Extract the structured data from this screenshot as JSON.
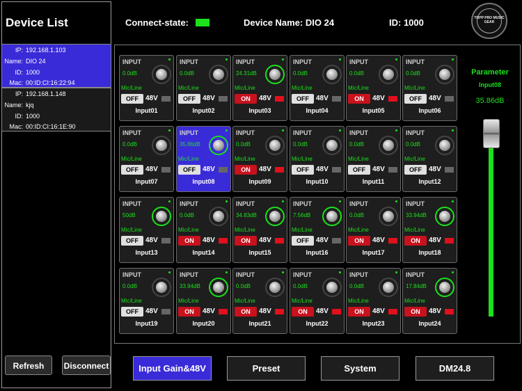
{
  "sidebar": {
    "title": "Device List",
    "devices": [
      {
        "ip_key": "IP:",
        "ip": "192.168.1.103",
        "name_key": "Name:",
        "name": "DIO 24",
        "id_key": "ID:",
        "id": "1000",
        "mac_key": "Mac:",
        "mac": "00:ID:CI:16:22:94"
      },
      {
        "ip_key": "IP:",
        "ip": "192.168.1.148",
        "name_key": "Name:",
        "name": "kjq",
        "id_key": "ID:",
        "id": "1000",
        "mac_key": "Mac:",
        "mac": "00:ID:CI:16:1E:90"
      }
    ],
    "refresh_label": "Refresh",
    "disconnect_label": "Disconnect"
  },
  "header": {
    "connect_label": "Connect-state:",
    "device_name_label": "Device Name: DIO 24",
    "id_label": "ID: 1000",
    "logo_text": "TOPP PRO MUSIC GEAR"
  },
  "colors": {
    "accent": "#3a2bd8",
    "green": "#1be01b",
    "red": "#c8121e"
  },
  "channels": [
    {
      "title": "INPUT",
      "value": "0.0dB",
      "mic": "Mic/Line",
      "phantom": "OFF",
      "v48": "48V",
      "name": "Input01",
      "knob_active": false,
      "selected": false
    },
    {
      "title": "INPUT",
      "value": "0.0dB",
      "mic": "Mic/Line",
      "phantom": "OFF",
      "v48": "48V",
      "name": "Input02",
      "knob_active": false,
      "selected": false
    },
    {
      "title": "INPUT",
      "value": "24.31dB",
      "mic": "Mic/Line",
      "phantom": "ON",
      "v48": "48V",
      "name": "Input03",
      "knob_active": true,
      "selected": false
    },
    {
      "title": "INPUT",
      "value": "0.0dB",
      "mic": "Mic/Line",
      "phantom": "OFF",
      "v48": "48V",
      "name": "Input04",
      "knob_active": false,
      "selected": false
    },
    {
      "title": "INPUT",
      "value": "0.0dB",
      "mic": "Mic/Line",
      "phantom": "ON",
      "v48": "48V",
      "name": "Input05",
      "knob_active": false,
      "selected": false
    },
    {
      "title": "INPUT",
      "value": "0.0dB",
      "mic": "Mic/Line",
      "phantom": "OFF",
      "v48": "48V",
      "name": "Input06",
      "knob_active": false,
      "selected": false
    },
    {
      "title": "INPUT",
      "value": "0.0dB",
      "mic": "Mic/Line",
      "phantom": "OFF",
      "v48": "48V",
      "name": "Input07",
      "knob_active": false,
      "selected": false
    },
    {
      "title": "INPUT",
      "value": "35.86dB",
      "mic": "Mic/Line",
      "phantom": "OFF",
      "v48": "48V",
      "name": "Input08",
      "knob_active": true,
      "selected": true
    },
    {
      "title": "INPUT",
      "value": "0.0dB",
      "mic": "Mic/Line",
      "phantom": "ON",
      "v48": "48V",
      "name": "Input09",
      "knob_active": false,
      "selected": false
    },
    {
      "title": "INPUT",
      "value": "0.0dB",
      "mic": "Mic/Line",
      "phantom": "OFF",
      "v48": "48V",
      "name": "Input10",
      "knob_active": false,
      "selected": false
    },
    {
      "title": "INPUT",
      "value": "0.0dB",
      "mic": "Mic/Line",
      "phantom": "OFF",
      "v48": "48V",
      "name": "Input11",
      "knob_active": false,
      "selected": false
    },
    {
      "title": "INPUT",
      "value": "0.0dB",
      "mic": "Mic/Line",
      "phantom": "OFF",
      "v48": "48V",
      "name": "Input12",
      "knob_active": false,
      "selected": false
    },
    {
      "title": "INPUT",
      "value": "50dB",
      "mic": "Mic/Line",
      "phantom": "OFF",
      "v48": "48V",
      "name": "Input13",
      "knob_active": true,
      "selected": false
    },
    {
      "title": "INPUT",
      "value": "0.0dB",
      "mic": "Mic/Line",
      "phantom": "ON",
      "v48": "48V",
      "name": "Input14",
      "knob_active": false,
      "selected": false
    },
    {
      "title": "INPUT",
      "value": "34.83dB",
      "mic": "Mic/Line",
      "phantom": "ON",
      "v48": "48V",
      "name": "Input15",
      "knob_active": true,
      "selected": false
    },
    {
      "title": "INPUT",
      "value": "7.56dB",
      "mic": "Mic/Line",
      "phantom": "OFF",
      "v48": "48V",
      "name": "Input16",
      "knob_active": true,
      "selected": false
    },
    {
      "title": "INPUT",
      "value": "0.0dB",
      "mic": "Mic/Line",
      "phantom": "ON",
      "v48": "48V",
      "name": "Input17",
      "knob_active": false,
      "selected": false
    },
    {
      "title": "INPUT",
      "value": "33.94dB",
      "mic": "Mic/Line",
      "phantom": "ON",
      "v48": "48V",
      "name": "Input18",
      "knob_active": true,
      "selected": false
    },
    {
      "title": "INPUT",
      "value": "0.0dB",
      "mic": "Mic/Line",
      "phantom": "OFF",
      "v48": "48V",
      "name": "Input19",
      "knob_active": false,
      "selected": false
    },
    {
      "title": "INPUT",
      "value": "33.94dB",
      "mic": "Mic/Line",
      "phantom": "ON",
      "v48": "48V",
      "name": "Input20",
      "knob_active": true,
      "selected": false
    },
    {
      "title": "INPUT",
      "value": "0.0dB",
      "mic": "Mic/Line",
      "phantom": "ON",
      "v48": "48V",
      "name": "Input21",
      "knob_active": false,
      "selected": false
    },
    {
      "title": "INPUT",
      "value": "0.0dB",
      "mic": "Mic/Line",
      "phantom": "ON",
      "v48": "48V",
      "name": "Input22",
      "knob_active": false,
      "selected": false
    },
    {
      "title": "INPUT",
      "value": "0.0dB",
      "mic": "Mic/Line",
      "phantom": "ON",
      "v48": "48V",
      "name": "Input23",
      "knob_active": false,
      "selected": false
    },
    {
      "title": "INPUT",
      "value": "17.84dB",
      "mic": "Mic/Line",
      "phantom": "ON",
      "v48": "48V",
      "name": "Input24",
      "knob_active": true,
      "selected": false
    }
  ],
  "parameter": {
    "title": "Parameter",
    "input": "Input08",
    "value": "35.86dB",
    "fader_level_fraction": 1.0
  },
  "tabs": [
    {
      "label": "Input Gain&48V",
      "active": true
    },
    {
      "label": "Preset",
      "active": false
    },
    {
      "label": "System",
      "active": false
    },
    {
      "label": "DM24.8",
      "active": false
    }
  ]
}
